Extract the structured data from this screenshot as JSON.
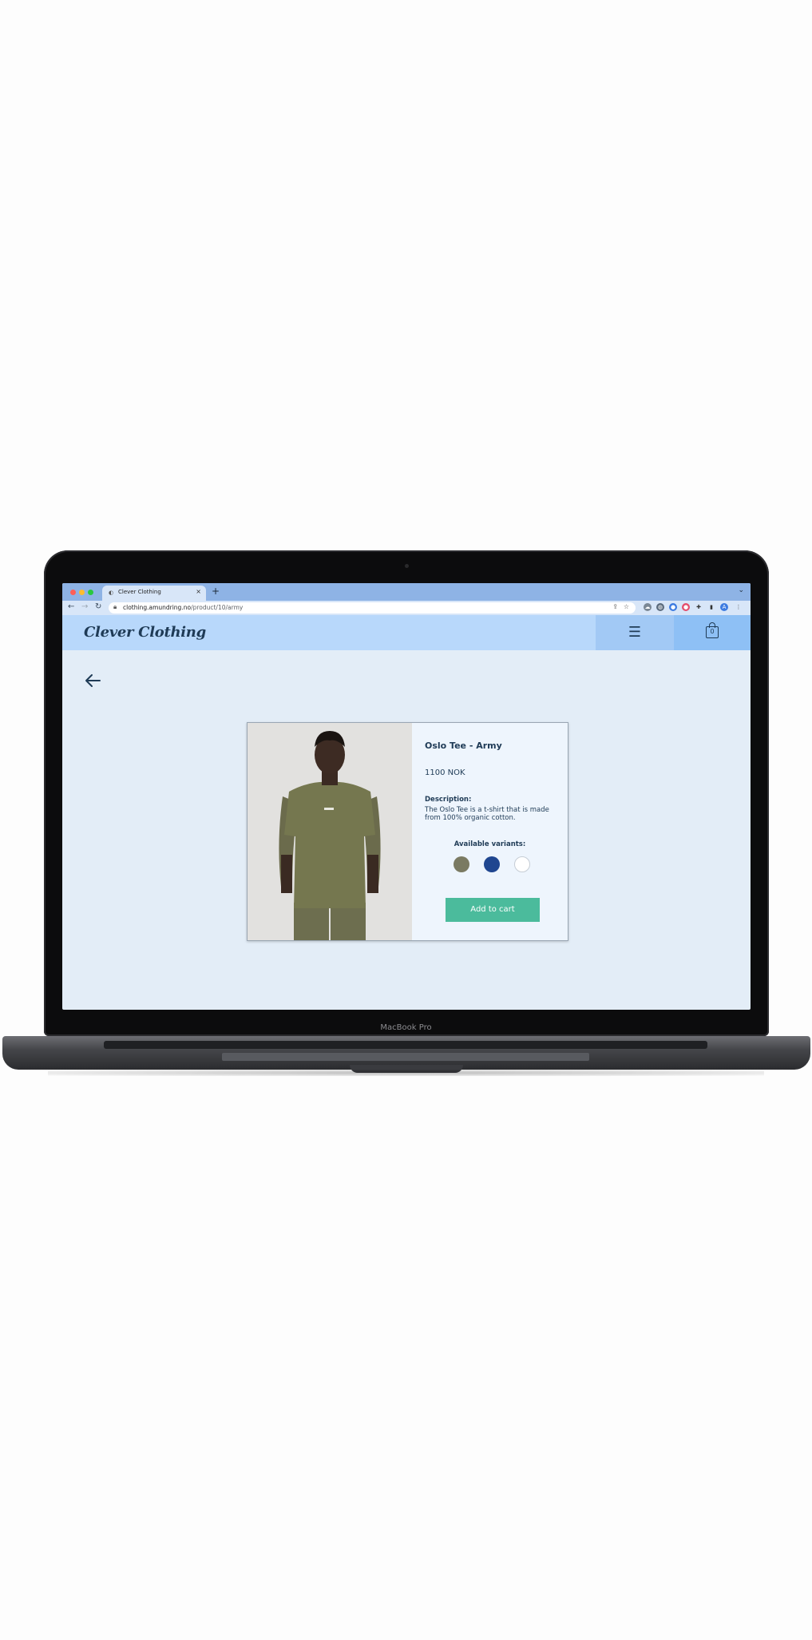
{
  "device": {
    "label": "MacBook Pro"
  },
  "browser": {
    "tab_title": "Clever Clothing",
    "url_host": "clothing.amundring.no",
    "url_path": "/product/10/army"
  },
  "site": {
    "logo": "Clever Clothing",
    "cart_count": "0"
  },
  "product": {
    "title": "Oslo Tee - Army",
    "price": "1100 NOK",
    "description_label": "Description:",
    "description": "The Oslo Tee is a t-shirt that is made from 100% organic cotton.",
    "variants_label": "Available variants:",
    "variants": [
      {
        "name": "army",
        "color": "#7a7a62"
      },
      {
        "name": "navy",
        "color": "#1f4690"
      },
      {
        "name": "white",
        "color": "#ffffff"
      }
    ],
    "add_to_cart": "Add to cart"
  }
}
